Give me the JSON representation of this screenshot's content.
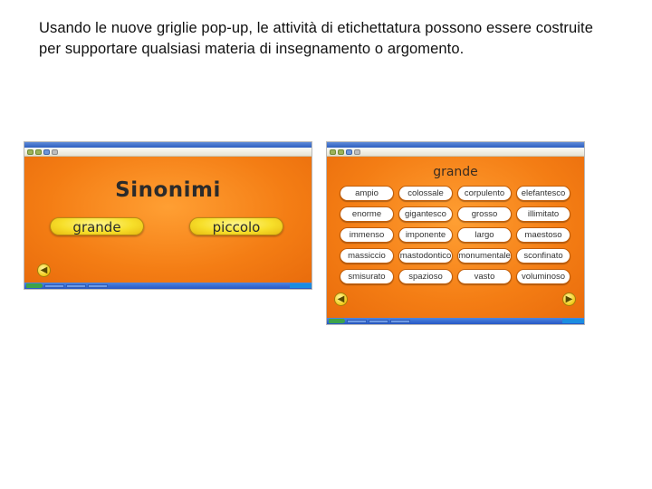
{
  "caption": "Usando le nuove griglie pop-up, le attività di etichettatura possono essere costruite per supportare qualsiasi materia di insegnamento o argomento.",
  "screenshot1": {
    "title": "Sinonimi",
    "option_left": "grande",
    "option_right": "piccolo"
  },
  "screenshot2": {
    "title": "grande",
    "cells": [
      "ampio",
      "colossale",
      "corpulento",
      "elefantesco",
      "enorme",
      "gigantesco",
      "grosso",
      "illimitato",
      "immenso",
      "imponente",
      "largo",
      "maestoso",
      "massiccio",
      "mastodontico",
      "monumentale",
      "sconfinato",
      "smisurato",
      "spazioso",
      "vasto",
      "voluminoso"
    ]
  },
  "colors": {
    "stage": "#f47d14",
    "pill": "#f7df2a",
    "cell": "#ffffff"
  }
}
